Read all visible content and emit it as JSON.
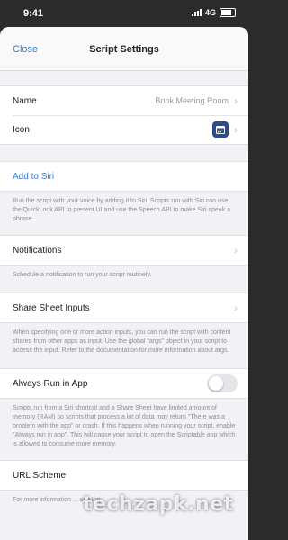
{
  "status": {
    "time": "9:41",
    "network": "4G"
  },
  "nav": {
    "close_label": "Close",
    "title": "Script Settings"
  },
  "general": {
    "name_label": "Name",
    "name_value": "Book Meeting Room",
    "icon_label": "Icon"
  },
  "siri": {
    "add_label": "Add to Siri",
    "footnote": "Run the script with your voice by adding it to Siri. Scripts run with Siri can use the QuickLook API to present UI and use the Speech API to make Siri speak a phrase."
  },
  "notifications": {
    "label": "Notifications",
    "footnote": "Schedule a notification to run your script routinely."
  },
  "share_sheet": {
    "label": "Share Sheet Inputs",
    "footnote": "When specifying one or more action inputs, you can run the script with content shared from other apps as input. Use the global \"args\" object in your script to access the input. Refer to the documentation for more information about args."
  },
  "always_run": {
    "label": "Always Run in App",
    "enabled": false,
    "footnote": "Scripts run from a Siri shortcut and a Share Sheet have limited amount of memory (RAM) so scripts that process a lot of data may return \"There was a problem with the app\" or crash. If this happens when running your script, enable \"Always run in app\". This will cause your script to open the Scriptable app which is allowed to consume more memory."
  },
  "url_scheme": {
    "label": "URL Scheme",
    "footnote": "For more information ... see the"
  },
  "watermark": "techzapk.net"
}
